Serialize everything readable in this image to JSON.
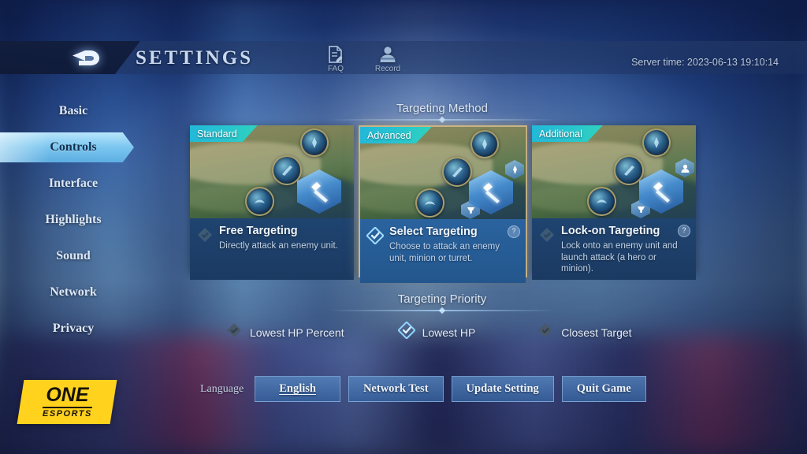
{
  "header": {
    "title": "SETTINGS",
    "back_icon": "back-arrow-icon",
    "icons": [
      {
        "name": "faq-icon",
        "label": "FAQ"
      },
      {
        "name": "record-icon",
        "label": "Record"
      }
    ],
    "server_time": "Server time: 2023-06-13 19:10:14"
  },
  "sidebar": {
    "items": [
      {
        "label": "Basic",
        "active": false
      },
      {
        "label": "Controls",
        "active": true
      },
      {
        "label": "Interface",
        "active": false
      },
      {
        "label": "Highlights",
        "active": false
      },
      {
        "label": "Sound",
        "active": false
      },
      {
        "label": "Network",
        "active": false
      },
      {
        "label": "Privacy",
        "active": false
      }
    ]
  },
  "targeting_method": {
    "heading": "Targeting Method",
    "cards": [
      {
        "badge": "Standard",
        "title": "Free Targeting",
        "desc": "Directly attack an enemy unit.",
        "selected": false,
        "has_help": false
      },
      {
        "badge": "Advanced",
        "title": "Select Targeting",
        "desc": "Choose to attack an enemy unit, minion or turret.",
        "selected": true,
        "has_help": true,
        "help_label": "?"
      },
      {
        "badge": "Additional",
        "title": "Lock-on Targeting",
        "desc": "Lock onto an enemy unit and launch attack (a hero or minion).",
        "selected": false,
        "has_help": true,
        "help_label": "?"
      }
    ]
  },
  "targeting_priority": {
    "heading": "Targeting Priority",
    "options": [
      {
        "label": "Lowest HP Percent",
        "selected": false
      },
      {
        "label": "Lowest HP",
        "selected": true
      },
      {
        "label": "Closest Target",
        "selected": false
      }
    ]
  },
  "bottom_bar": {
    "language_label": "Language",
    "buttons": [
      {
        "label": "English",
        "underlined": true
      },
      {
        "label": "Network Test",
        "underlined": false
      },
      {
        "label": "Update Setting",
        "underlined": false
      },
      {
        "label": "Quit Game",
        "underlined": false
      }
    ]
  },
  "watermark": {
    "line1": "ONE",
    "line2": "ESPORTS"
  },
  "colors": {
    "badge_gradient_start": "#23b8d8",
    "badge_gradient_end": "#2fd2bd",
    "selected_border": "#c8b488",
    "selected_body": "#2a639f",
    "card_body": "#1f4470",
    "accent_cyan": "#8cd7ff",
    "watermark_bg": "#ffd21e"
  }
}
